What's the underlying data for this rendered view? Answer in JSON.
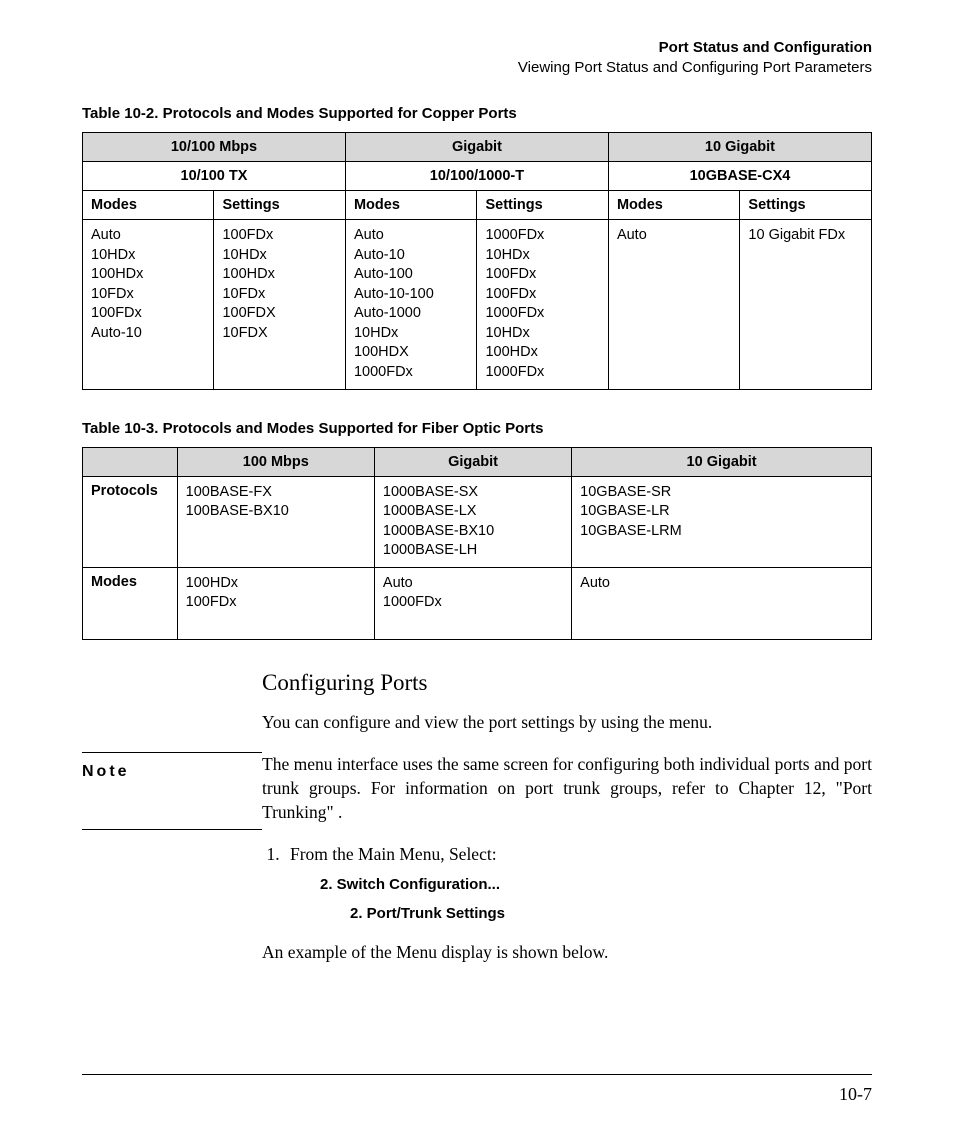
{
  "header": {
    "title_bold": "Port Status and Configuration",
    "subtitle": "Viewing Port Status and Configuring Port Parameters"
  },
  "table1": {
    "caption": "Table 10-2.   Protocols and Modes Supported for Copper Ports",
    "group_headers": [
      "10/100 Mbps",
      "Gigabit",
      "10 Gigabit"
    ],
    "sub_headers": [
      "10/100 TX",
      "10/100/1000-T",
      "10GBASE-CX4"
    ],
    "col_pairs": [
      "Modes",
      "Settings",
      "Modes",
      "Settings",
      "Modes",
      "Settings"
    ],
    "row": [
      "Auto\n10HDx\n100HDx\n10FDx\n100FDx\nAuto-10",
      "100FDx\n10HDx\n100HDx\n10FDx\n100FDX\n10FDX",
      "Auto\nAuto-10\nAuto-100\nAuto-10-100\nAuto-1000\n10HDx\n100HDX\n1000FDx",
      "1000FDx\n10HDx\n100FDx\n100FDx\n1000FDx\n10HDx\n100HDx\n1000FDx",
      "Auto",
      "10 Gigabit FDx"
    ]
  },
  "table2": {
    "caption": "Table 10-3.   Protocols and Modes Supported for Fiber Optic Ports",
    "headers": [
      "",
      "100 Mbps",
      "Gigabit",
      "10 Gigabit"
    ],
    "rows": [
      {
        "label": "Protocols",
        "cells": [
          "100BASE-FX\n100BASE-BX10",
          "1000BASE-SX\n1000BASE-LX\n1000BASE-BX10\n1000BASE-LH",
          "10GBASE-SR\n10GBASE-LR\n10GBASE-LRM"
        ]
      },
      {
        "label": "Modes",
        "cells": [
          "100HDx\n100FDx",
          "Auto\n1000FDx",
          "Auto"
        ]
      }
    ]
  },
  "section": {
    "heading": "Configuring Ports",
    "intro": "You can configure and view the port settings by using the menu.",
    "note_label": "Note",
    "note_body": "The menu interface uses the same screen for configuring both individual ports and port trunk groups. For information on port trunk groups, refer to Chapter 12, \"Port Trunking\" .",
    "step1_lead": "From the Main Menu, Select:",
    "menu_lvl1": "2. Switch Configuration...",
    "menu_lvl2": "2. Port/Trunk Settings",
    "closing": "An example of the Menu display is shown below."
  },
  "page_number": "10-7"
}
